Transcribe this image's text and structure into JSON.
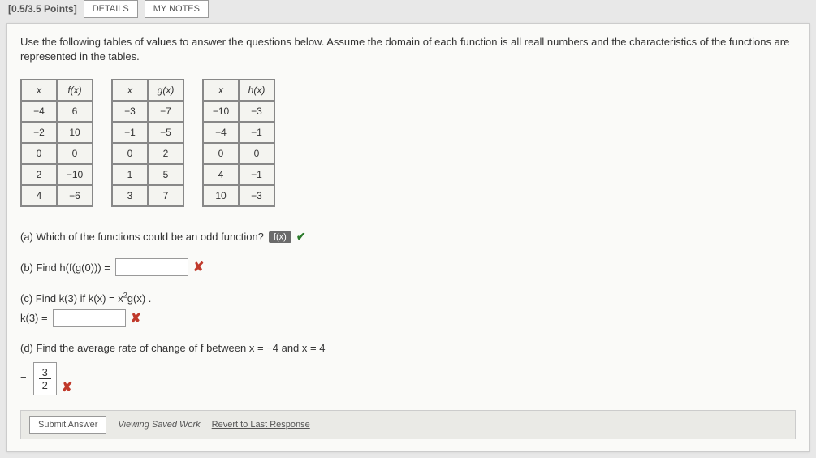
{
  "topbar": {
    "points": "[0.5/3.5 Points]",
    "details_btn": "DETAILS",
    "notes_btn": "MY NOTES"
  },
  "prompt": "Use the following tables of values to answer the questions below. Assume the domain of each function is all reall numbers and the characteristics of the functions are represented in the tables.",
  "tables": {
    "f": {
      "head_x": "x",
      "head_y": "f(x)",
      "rows": [
        [
          "−4",
          "6"
        ],
        [
          "−2",
          "10"
        ],
        [
          "0",
          "0"
        ],
        [
          "2",
          "−10"
        ],
        [
          "4",
          "−6"
        ]
      ]
    },
    "g": {
      "head_x": "x",
      "head_y": "g(x)",
      "rows": [
        [
          "−3",
          "−7"
        ],
        [
          "−1",
          "−5"
        ],
        [
          "0",
          "2"
        ],
        [
          "1",
          "5"
        ],
        [
          "3",
          "7"
        ]
      ]
    },
    "h": {
      "head_x": "x",
      "head_y": "h(x)",
      "rows": [
        [
          "−10",
          "−3"
        ],
        [
          "−4",
          "−1"
        ],
        [
          "0",
          "0"
        ],
        [
          "4",
          "−1"
        ],
        [
          "10",
          "−3"
        ]
      ]
    }
  },
  "qa": {
    "a_text": "(a) Which of the functions could be an odd function?",
    "a_answer": "f(x)",
    "b_text": "(b) Find  h(f(g(0)))  =",
    "c_text1": "(c) Find  k(3)  if  k(x) = x",
    "c_text2": "g(x) .",
    "c_k3": "k(3)  =",
    "d_text": "(d) Find the average rate of change of f between  x = −4  and  x = 4",
    "d_num": "3",
    "d_den": "2",
    "d_neg": "−"
  },
  "footer": {
    "submit": "Submit Answer",
    "status": "Viewing Saved Work",
    "revert": "Revert to Last Response"
  }
}
